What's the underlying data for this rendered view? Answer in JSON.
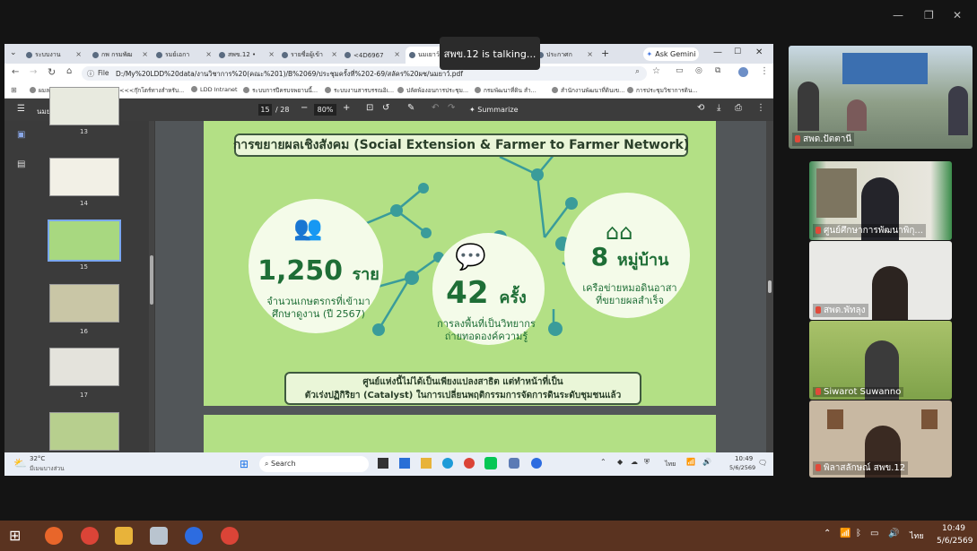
{
  "meeting": {
    "talking_label": "สพข.12 is talking..."
  },
  "browser": {
    "tabs": [
      "ระบบงาน",
      "กพ กรมพัฒ",
      "รมย์เอกา",
      "สพข.12 •",
      "รายชื่อผู้เข้า",
      "<4D6967",
      "นมเยาว์.pdf",
      "ประกาศก"
    ],
    "ask_gemini": "Ask Gemini",
    "file_label": "File",
    "url": "D:/My%20LDD%20data/งานวิชาการ%20(คณะ%201)/B%2069/ประชุมครั้งที่%202-69/สลัคร%20ผช/นมยาว์.pdf",
    "bookmarks": [
      "ผมลดด Archives - P...",
      "<<<กุ๊กโตร์ทางสำหรับ...",
      "LDD Intranet",
      "ระบบการปีครบจพยานนี้...",
      "ระบบงานสารบรรณอิเ...",
      "ปลัดพ้องอนการประชุม...",
      "กรมพัฒนาที่ดิน สำ...",
      "สำนักงานพัฒนาที่ดินเข...",
      "การประชุมวิชาการดิน..."
    ]
  },
  "pdf": {
    "filename": "นมยาว์.pdf",
    "page_current": "15",
    "page_total": "/ 28",
    "zoom": "80%",
    "summarize": "Summarize",
    "thumb_pages": [
      "13",
      "14",
      "15",
      "16",
      "17"
    ]
  },
  "slide": {
    "title": "การขยายผลเชิงสังคม (Social Extension & Farmer to Farmer Network)",
    "stat1_value": "1,250",
    "stat1_unit": "ราย",
    "stat1_desc1": "จำนวนเกษตรกรที่เข้ามา",
    "stat1_desc2": "ศึกษาดูงาน (ปี 2567)",
    "stat2_value": "42",
    "stat2_unit": "ครั้ง",
    "stat2_desc1": "การลงพื้นที่เป็นวิทยากร",
    "stat2_desc2": "ถ่ายทอดองค์ความรู้",
    "stat3_value": "8",
    "stat3_unit": "หมู่บ้าน",
    "stat3_desc1": "เครือข่ายหมอดินอาสา",
    "stat3_desc2": "ที่ขยายผลสำเร็จ",
    "footer1": "ศูนย์แห่งนี้ไม่ได้เป็นเพียงแปลงสาธิต แต่ทำหน้าที่เป็น",
    "footer2": "ตัวเร่งปฏิกิริยา (Catalyst) ในการเปลี่ยนพฤติกรรมการจัดการดินระดับชุมชนแล้ว"
  },
  "inner_taskbar": {
    "weather_temp": "32°C",
    "weather_desc": "มีเมฆบางส่วน",
    "search": "Search",
    "lang": "ไทย",
    "time": "10:49",
    "date": "5/6/2569"
  },
  "participants": [
    "สพด.ปัตตานี",
    "ศูนย์ศึกษาการพัฒนาพิกุ...",
    "สพด.พัทลุง",
    "Siwarot Suwanno",
    "พิลาสลักษณ์ สพข.12"
  ],
  "outer_taskbar": {
    "lang": "ไทย",
    "time": "10:49",
    "date": "5/6/2569"
  }
}
